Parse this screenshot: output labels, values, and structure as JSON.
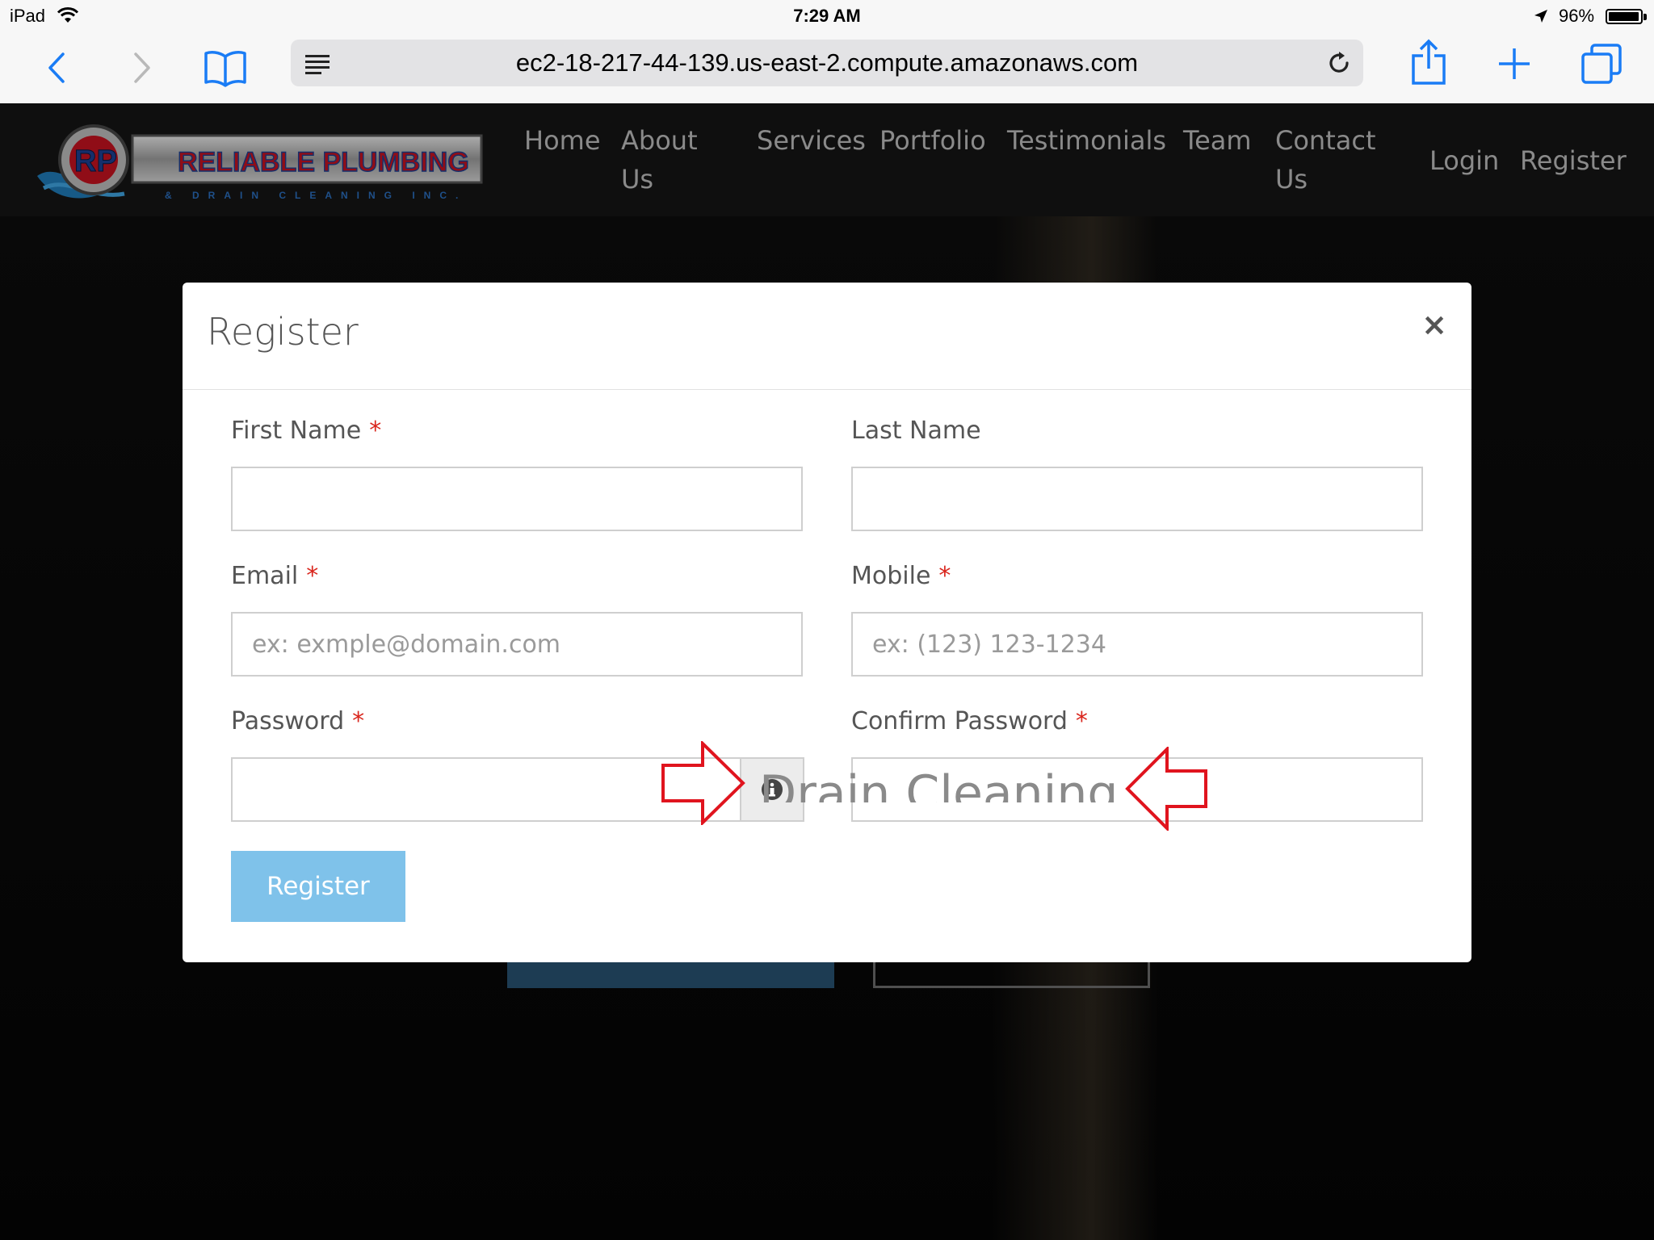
{
  "status_bar": {
    "device": "iPad",
    "time": "7:29 AM",
    "battery": "96%"
  },
  "browser": {
    "url": "ec2-18-217-44-139.us-east-2.compute.amazonaws.com"
  },
  "site": {
    "logo_text": "RELIABLE PLUMBING",
    "logo_subtext": "& DRAIN CLEANING INC.",
    "logo_badge": "RP",
    "nav": {
      "home": "Home",
      "about_1": "About",
      "about_2": "Us",
      "services": "Services",
      "portfolio": "Portfolio",
      "testimonials": "Testimonials",
      "team": "Team",
      "contact_1": "Contact",
      "contact_2": "Us",
      "login": "Login",
      "register": "Register"
    }
  },
  "modal": {
    "title": "Register",
    "close": "×",
    "required_mark": "*",
    "first_name_label": "First Name",
    "last_name_label": "Last Name",
    "email_label": "Email",
    "email_placeholder": "ex: exmple@domain.com",
    "mobile_label": "Mobile",
    "mobile_placeholder": "ex: (123) 123-1234",
    "password_label": "Password",
    "confirm_password_label": "Confirm Password",
    "background_text": "Drain Cleaning",
    "submit": "Register"
  },
  "colors": {
    "required": "#d9251c",
    "register_button": "#7fc2ea",
    "annotation_arrow": "#e0141e"
  }
}
